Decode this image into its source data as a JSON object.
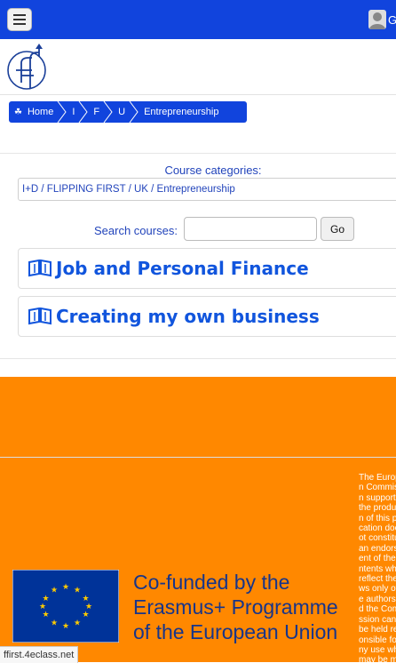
{
  "header": {
    "user_initial": "G"
  },
  "breadcrumb": {
    "home": "Home",
    "items": [
      "I",
      "F",
      "U",
      "Entrepreneurship"
    ]
  },
  "categories": {
    "label": "Course categories:",
    "selected": "I+D / FLIPPING FIRST / UK / Entrepreneurship"
  },
  "search": {
    "label": "Search courses:",
    "value": "",
    "button": "Go"
  },
  "courses": [
    {
      "title": "Job and Personal Finance"
    },
    {
      "title": "Creating my own business"
    }
  ],
  "footer": {
    "cofund": [
      "Co-funded by the",
      "Erasmus+ Programme",
      "of the European Union"
    ],
    "disclaimer": "The European Commission support for the production of this publication does not constitute an endorsement of the contents which reflect the views only of the authors, and the Commission cannot be held responsible for any use which may be made of the information"
  },
  "status_url": "ffirst.4eclass.net",
  "colors": {
    "navbar": "#1144dd",
    "accent": "#1155dd",
    "footer_orange": "#ff8800",
    "eu_blue": "#003399",
    "eu_star": "#ffcc00"
  },
  "icons": {
    "menu": "hamburger-icon",
    "user": "user-icon",
    "logo": "site-logo",
    "home": "home-icon",
    "course": "book-icon"
  }
}
